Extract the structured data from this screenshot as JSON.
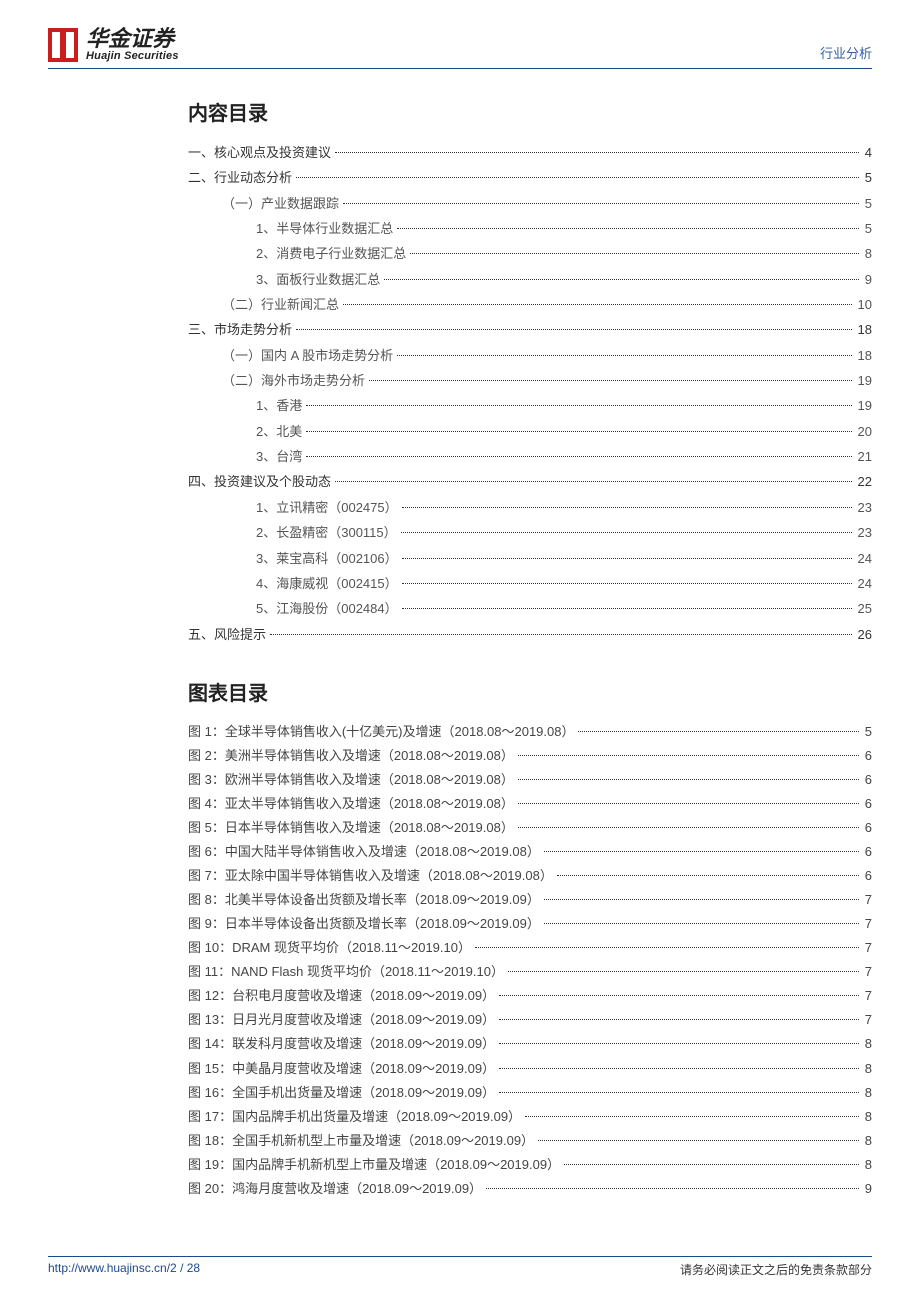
{
  "brand": {
    "cn": "华金证券",
    "en": "Huajin Securities"
  },
  "header_right": "行业分析",
  "toc_heading": "内容目录",
  "fig_heading": "图表目录",
  "toc": [
    {
      "lvl": 0,
      "label": "一、核心观点及投资建议",
      "page": "4"
    },
    {
      "lvl": 0,
      "label": "二、行业动态分析",
      "page": "5"
    },
    {
      "lvl": 1,
      "label": "（一）产业数据跟踪",
      "page": "5"
    },
    {
      "lvl": 2,
      "label": "1、半导体行业数据汇总",
      "page": "5"
    },
    {
      "lvl": 2,
      "label": "2、消费电子行业数据汇总",
      "page": "8"
    },
    {
      "lvl": 2,
      "label": "3、面板行业数据汇总",
      "page": "9"
    },
    {
      "lvl": 1,
      "label": "（二）行业新闻汇总",
      "page": "10"
    },
    {
      "lvl": 0,
      "label": "三、市场走势分析",
      "page": "18"
    },
    {
      "lvl": 1,
      "label": "（一）国内 A 股市场走势分析",
      "page": "18"
    },
    {
      "lvl": 1,
      "label": "（二）海外市场走势分析",
      "page": "19"
    },
    {
      "lvl": 2,
      "label": "1、香港",
      "page": "19"
    },
    {
      "lvl": 2,
      "label": "2、北美",
      "page": "20"
    },
    {
      "lvl": 2,
      "label": "3、台湾",
      "page": "21"
    },
    {
      "lvl": 0,
      "label": "四、投资建议及个股动态",
      "page": "22"
    },
    {
      "lvl": 2,
      "label": "1、立讯精密（002475）",
      "page": "23"
    },
    {
      "lvl": 2,
      "label": "2、长盈精密（300115）",
      "page": "23"
    },
    {
      "lvl": 2,
      "label": "3、莱宝高科（002106）",
      "page": "24"
    },
    {
      "lvl": 2,
      "label": "4、海康威视（002415）",
      "page": "24"
    },
    {
      "lvl": 2,
      "label": "5、江海股份（002484）",
      "page": "25"
    },
    {
      "lvl": 0,
      "label": "五、风险提示",
      "page": "26"
    }
  ],
  "figures": [
    {
      "label": "图 1：全球半导体销售收入(十亿美元)及增速（2018.08～2019.08）",
      "page": "5"
    },
    {
      "label": "图 2：美洲半导体销售收入及增速（2018.08～2019.08）",
      "page": "6"
    },
    {
      "label": "图 3：欧洲半导体销售收入及增速（2018.08～2019.08）",
      "page": "6"
    },
    {
      "label": "图 4：亚太半导体销售收入及增速（2018.08～2019.08）",
      "page": "6"
    },
    {
      "label": "图 5：日本半导体销售收入及增速（2018.08～2019.08）",
      "page": "6"
    },
    {
      "label": "图 6：中国大陆半导体销售收入及增速（2018.08～2019.08）",
      "page": "6"
    },
    {
      "label": "图 7：亚太除中国半导体销售收入及增速（2018.08～2019.08）",
      "page": "6"
    },
    {
      "label": "图 8：北美半导体设备出货额及增长率（2018.09～2019.09）",
      "page": "7"
    },
    {
      "label": "图 9：日本半导体设备出货额及增长率（2018.09～2019.09）",
      "page": "7"
    },
    {
      "label": "图 10：DRAM 现货平均价（2018.11～2019.10）",
      "page": "7"
    },
    {
      "label": "图 11：NAND Flash 现货平均价（2018.11～2019.10）",
      "page": "7"
    },
    {
      "label": "图 12：台积电月度营收及增速（2018.09～2019.09）",
      "page": "7"
    },
    {
      "label": "图 13：日月光月度营收及增速（2018.09～2019.09）",
      "page": "7"
    },
    {
      "label": "图 14：联发科月度营收及增速（2018.09～2019.09）",
      "page": "8"
    },
    {
      "label": "图 15：中美晶月度营收及增速（2018.09～2019.09）",
      "page": "8"
    },
    {
      "label": "图 16：全国手机出货量及增速（2018.09～2019.09）",
      "page": "8"
    },
    {
      "label": "图 17：国内品牌手机出货量及增速（2018.09～2019.09）",
      "page": "8"
    },
    {
      "label": "图 18：全国手机新机型上市量及增速（2018.09～2019.09）",
      "page": "8"
    },
    {
      "label": "图 19：国内品牌手机新机型上市量及增速（2018.09～2019.09）",
      "page": "8"
    },
    {
      "label": "图 20：鸿海月度营收及增速（2018.09～2019.09）",
      "page": "9"
    }
  ],
  "footer": {
    "left": "http://www.huajinsc.cn/2 / 28",
    "right": "请务必阅读正文之后的免责条款部分"
  }
}
